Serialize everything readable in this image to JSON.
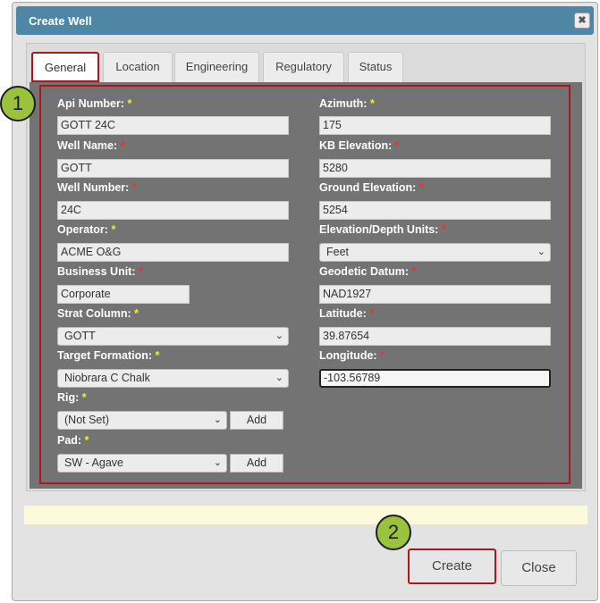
{
  "dialog": {
    "title": "Create Well",
    "close_glyph": "✖"
  },
  "tabs": [
    {
      "label": "General"
    },
    {
      "label": "Location"
    },
    {
      "label": "Engineering"
    },
    {
      "label": "Regulatory"
    },
    {
      "label": "Status"
    }
  ],
  "required_mark": "*",
  "fields": {
    "api_number": {
      "label": "Api Number:",
      "value": "GOTT 24C"
    },
    "well_name": {
      "label": "Well Name:",
      "value": "GOTT"
    },
    "well_number": {
      "label": "Well Number:",
      "value": "24C"
    },
    "operator": {
      "label": "Operator:",
      "value": "ACME O&G"
    },
    "business_unit": {
      "label": "Business Unit:",
      "value": "Corporate"
    },
    "strat_column": {
      "label": "Strat Column:",
      "value": "GOTT"
    },
    "target_formation": {
      "label": "Target Formation:",
      "value": "Niobrara C Chalk"
    },
    "rig": {
      "label": "Rig:",
      "value": "(Not Set)",
      "add_label": "Add"
    },
    "pad": {
      "label": "Pad:",
      "value": "SW - Agave",
      "add_label": "Add"
    },
    "azimuth": {
      "label": "Azimuth:",
      "value": "175"
    },
    "kb_elevation": {
      "label": "KB Elevation:",
      "value": "5280"
    },
    "ground_elevation": {
      "label": "Ground Elevation:",
      "value": "5254"
    },
    "elevation_units": {
      "label": "Elevation/Depth Units:",
      "value": "Feet"
    },
    "geodetic_datum": {
      "label": "Geodetic Datum:",
      "value": "NAD1927"
    },
    "latitude": {
      "label": "Latitude:",
      "value": "39.87654"
    },
    "longitude": {
      "label": "Longitude:",
      "value": "-103.56789"
    }
  },
  "callouts": {
    "one": "1",
    "two": "2"
  },
  "buttons": {
    "create": "Create",
    "close": "Close"
  },
  "colors": {
    "title_bar": "#4f86a6",
    "highlight": "#b0151b",
    "callout": "#9ac23c",
    "form_bg": "#737373"
  }
}
